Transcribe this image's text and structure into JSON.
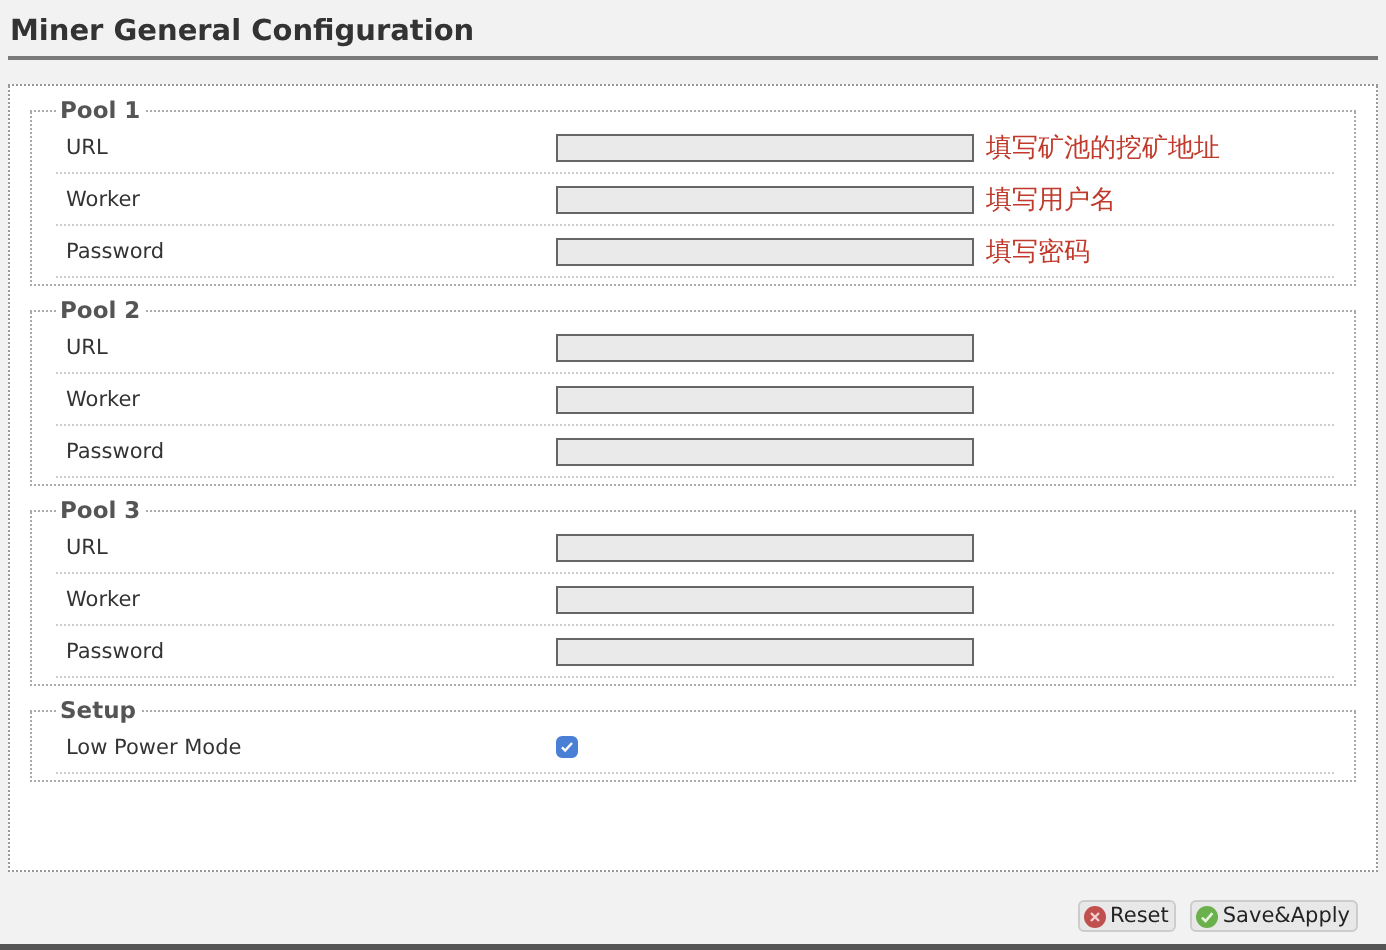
{
  "title": "Miner General Configuration",
  "sections": [
    {
      "legend": "Pool 1",
      "rows": [
        {
          "kind": "text",
          "label": "URL",
          "note": "填写矿池的挖矿地址"
        },
        {
          "kind": "text",
          "label": "Worker",
          "note": "填写用户名"
        },
        {
          "kind": "text",
          "label": "Password",
          "note": "填写密码"
        }
      ]
    },
    {
      "legend": "Pool 2",
      "rows": [
        {
          "kind": "text",
          "label": "URL"
        },
        {
          "kind": "text",
          "label": "Worker"
        },
        {
          "kind": "text",
          "label": "Password"
        }
      ]
    },
    {
      "legend": "Pool 3",
      "rows": [
        {
          "kind": "text",
          "label": "URL"
        },
        {
          "kind": "text",
          "label": "Worker"
        },
        {
          "kind": "text",
          "label": "Password"
        }
      ]
    },
    {
      "legend": "Setup",
      "rows": [
        {
          "kind": "checkbox",
          "label": "Low Power Mode",
          "checked": true
        }
      ]
    }
  ],
  "buttons": [
    {
      "kind": "reset",
      "label": "Reset"
    },
    {
      "kind": "save",
      "label": "Save&Apply"
    }
  ]
}
